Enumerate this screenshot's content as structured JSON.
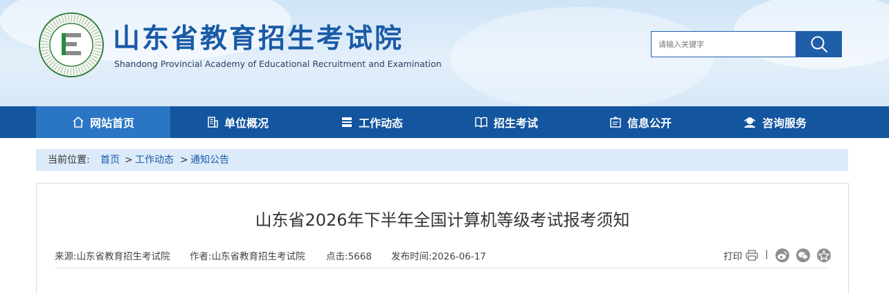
{
  "site": {
    "title": "山东省教育招生考试院",
    "subtitle": "Shandong Provincial Academy of Educational Recruitment and Examination",
    "logo_ring_text": "Shandong Educational Admission & Examination Authority"
  },
  "search": {
    "placeholder": "请输入关键字",
    "icon": "search-icon"
  },
  "nav": {
    "items": [
      {
        "label": "网站首页",
        "icon": "home-icon",
        "active": true
      },
      {
        "label": "单位概况",
        "icon": "building-icon"
      },
      {
        "label": "工作动态",
        "icon": "news-icon"
      },
      {
        "label": "招生考试",
        "icon": "book-icon"
      },
      {
        "label": "信息公开",
        "icon": "notice-icon"
      },
      {
        "label": "咨询服务",
        "icon": "support-icon"
      }
    ]
  },
  "breadcrumb": {
    "prefix": "当前位置:",
    "items": [
      "首页",
      "工作动态",
      "通知公告"
    ],
    "separator": ">"
  },
  "article": {
    "title": "山东省2026年下半年全国计算机等级考试报考须知",
    "source_label": "来源:",
    "source": "山东省教育招生考试院",
    "author_label": "作者:",
    "author": "山东省教育招生考试院",
    "clicks_label": "点击:",
    "clicks": "5668",
    "date_label": "发布时间:",
    "date": "2026-06-17",
    "print_label": "打印",
    "share_separator": "|",
    "share_icons": [
      "weibo-icon",
      "wechat-icon",
      "favorite-icon"
    ]
  },
  "colors": {
    "brand_blue": "#13559e",
    "nav_active": "#2a76c4",
    "title_blue": "#1a5aa6",
    "crumb_bg": "#dcebfa"
  }
}
